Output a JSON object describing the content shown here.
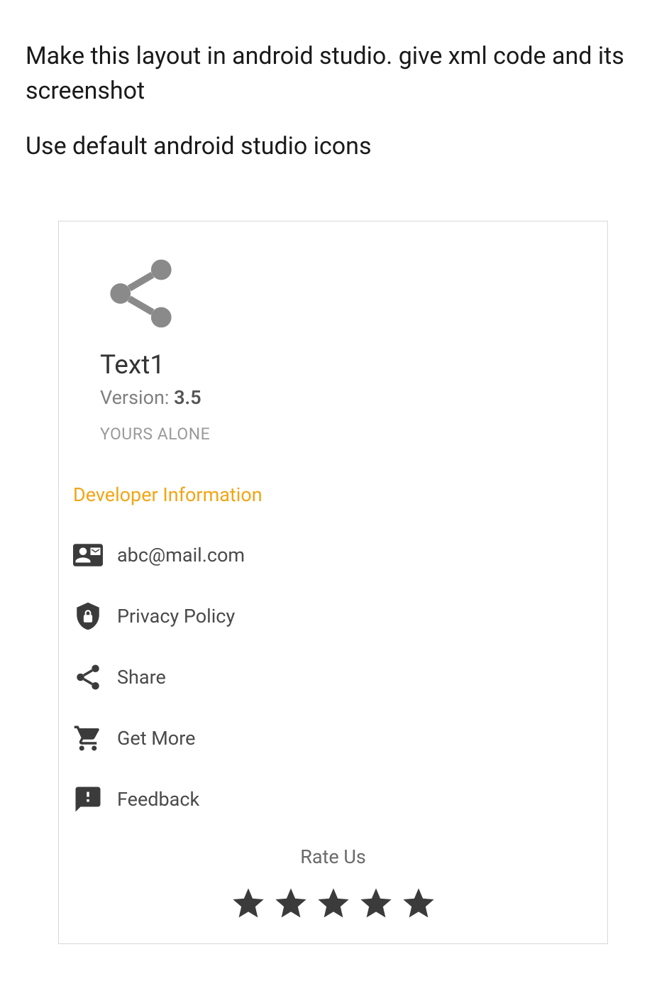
{
  "instructions": {
    "line1": "Make this layout in android studio. give xml code and its screenshot",
    "line2": "Use default android studio icons"
  },
  "app": {
    "title": "Text1",
    "version_label": "Version: ",
    "version_value": "3.5",
    "tagline": "YOURS ALONE"
  },
  "section": {
    "heading": "Developer Information"
  },
  "menu": {
    "email": "abc@mail.com",
    "privacy": "Privacy Policy",
    "share": "Share",
    "getmore": "Get More",
    "feedback": "Feedback"
  },
  "rate": {
    "title": "Rate Us",
    "count": 5
  },
  "colors": {
    "icon": "#3b3b3b",
    "heroIcon": "#8a8a8a",
    "accent": "#f2a516"
  }
}
